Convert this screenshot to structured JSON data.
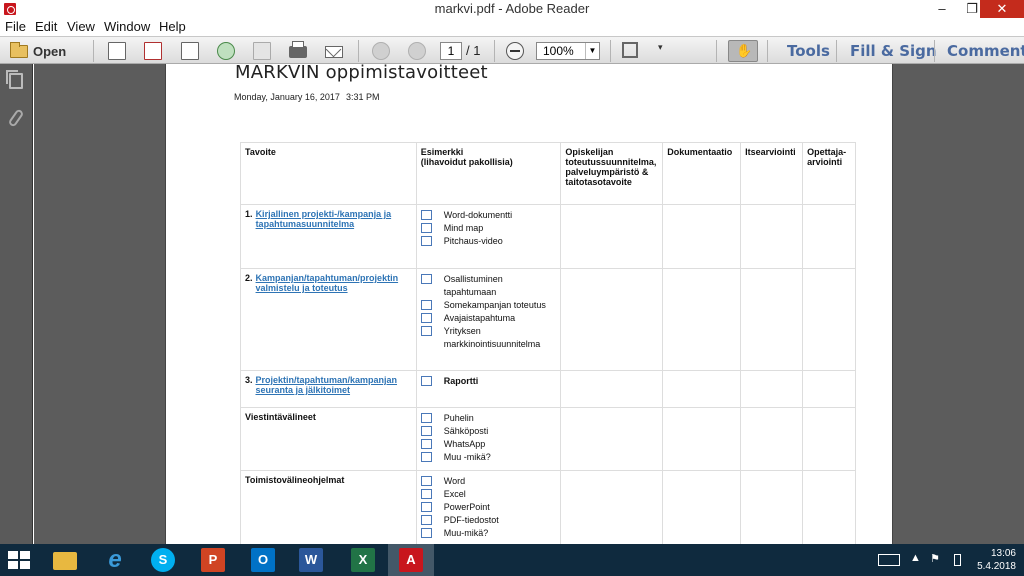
{
  "window": {
    "title": "markvi.pdf - Adobe Reader",
    "controls": {
      "minimize": "–",
      "restore": "❐",
      "close": "✕"
    }
  },
  "menu": [
    "File",
    "Edit",
    "View",
    "Window",
    "Help"
  ],
  "toolbar": {
    "open_label": "Open",
    "page_current": "1",
    "page_total": "/ 1",
    "zoom": "100%",
    "tools_label": "Tools",
    "fill_sign_label": "Fill & Sign",
    "comment_label": "Comment"
  },
  "document": {
    "title": "MARKVIN oppimistavoitteet",
    "date": "Monday, January 16, 2017",
    "time": "3:31 PM",
    "headers": [
      "Tavoite",
      "Esimerkki\n(lihavoidut pakollisia)",
      "Opiskelijan toteutussuunnitelma, palveluympäristö & taitotasotavoite",
      "Dokumentaatio",
      "Itsearviointi",
      "Opettaja-arviointi"
    ],
    "rows": [
      {
        "num": "1.",
        "goal": "Kirjallinen projekti-/kampanja ja tapahtumasuunnitelma",
        "items": [
          "Word-dokumentti",
          "Mind map",
          "Pitchaus-video"
        ]
      },
      {
        "num": "2.",
        "goal": "Kampanjan/tapahtuman/projektin valmistelu ja toteutus",
        "items": [
          "Osallistuminen tapahtumaan",
          "Somekampanjan toteutus",
          "Avajaistapahtuma",
          "Yrityksen markkinointisuunnitelma"
        ]
      },
      {
        "num": "3.",
        "goal": "Projektin/tapahtuman/kampanjan seuranta ja jälkitoimet",
        "items": [
          "Raportti"
        ]
      },
      {
        "num": "",
        "goal": "Viestintävälineet",
        "items": [
          "Puhelin",
          "Sähköposti",
          "WhatsApp",
          "Muu -mikä?"
        ]
      },
      {
        "num": "",
        "goal": "Toimistovälineohjelmat",
        "items": [
          "Word",
          "Excel",
          "PowerPoint",
          "PDF-tiedostot",
          "Muu-mikä?"
        ]
      }
    ]
  },
  "taskbar": {
    "apps": [
      "windows-start",
      "file-explorer",
      "internet-explorer",
      "skype",
      "powerpoint",
      "outlook",
      "word",
      "excel",
      "adobe-reader"
    ],
    "clock_time": "13:06",
    "clock_date": "5.4.2018"
  },
  "colors": {
    "link": "#2e74b5",
    "checkbox": "#4a78b8",
    "taskbar": "#0f2a3e",
    "toolbar_right_text": "#4a6aa0"
  }
}
